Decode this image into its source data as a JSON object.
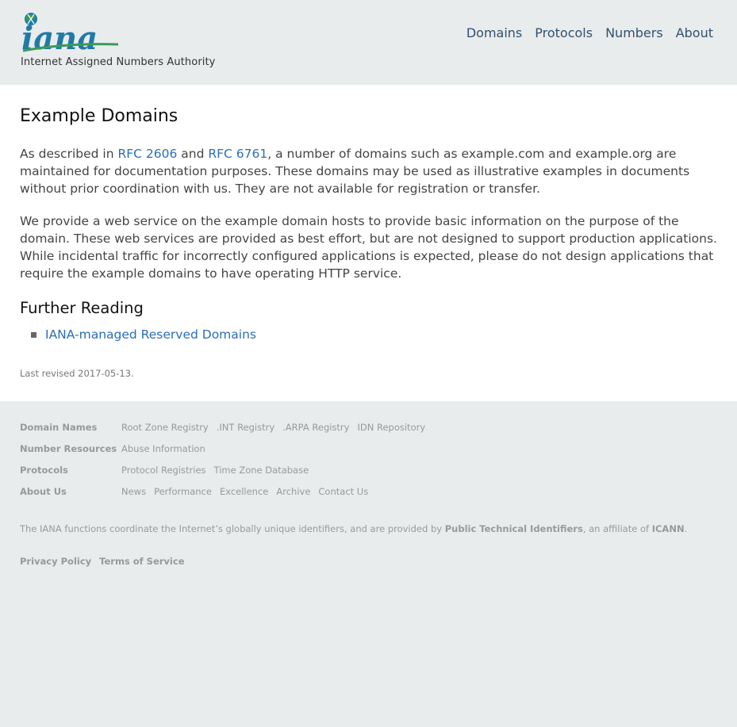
{
  "header": {
    "logo_text": "iana",
    "logo_subtitle": "Internet Assigned Numbers Authority",
    "nav": [
      "Domains",
      "Protocols",
      "Numbers",
      "About"
    ]
  },
  "main": {
    "title": "Example Domains",
    "para1": {
      "prefix": "As described in ",
      "link1": "RFC 2606",
      "mid": " and ",
      "link2": "RFC 6761",
      "suffix": ", a number of domains such as example.com and example.org are maintained for documentation purposes. These domains may be used as illustrative examples in documents without prior coordination with us. They are not available for registration or transfer."
    },
    "para2": "We provide a web service on the example domain hosts to provide basic information on the purpose of the domain. These web services are provided as best effort, but are not designed to support production applications. While incidental traffic for incorrectly configured applications is expected, please do not design applications that require the example domains to have operating HTTP service.",
    "further_reading_title": "Further Reading",
    "further_reading_links": [
      "IANA-managed Reserved Domains"
    ],
    "last_revised": "Last revised 2017-05-13."
  },
  "footer": {
    "rows": [
      {
        "heading": "Domain Names",
        "links": [
          "Root Zone Registry",
          ".INT Registry",
          ".ARPA Registry",
          "IDN Repository"
        ]
      },
      {
        "heading": "Number Resources",
        "links": [
          "Abuse Information"
        ]
      },
      {
        "heading": "Protocols",
        "links": [
          "Protocol Registries",
          "Time Zone Database"
        ]
      },
      {
        "heading": "About Us",
        "links": [
          "News",
          "Performance",
          "Excellence",
          "Archive",
          "Contact Us"
        ]
      }
    ],
    "note": {
      "prefix": "The IANA functions coordinate the Internet’s globally unique identifiers, and are provided by ",
      "pti": "Public Technical Identifiers",
      "mid": ", an affiliate of ",
      "icann": "ICANN",
      "suffix": "."
    },
    "legal": [
      "Privacy Policy",
      "Terms of Service"
    ]
  },
  "colors": {
    "link": "#2a6ebb",
    "nav": "#305070",
    "logo_green": "#3b9a5a",
    "logo_blue": "#1f7aa8"
  }
}
